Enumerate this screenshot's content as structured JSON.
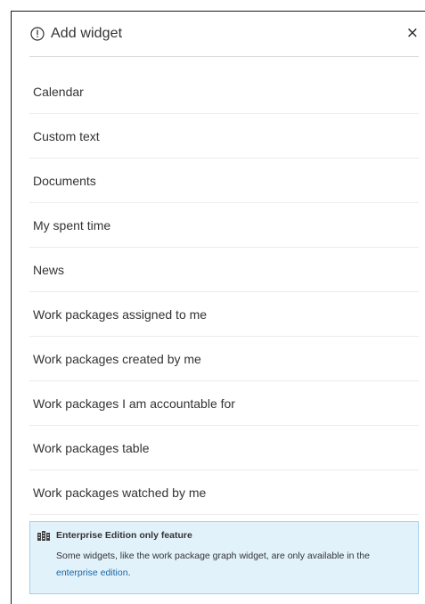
{
  "modal": {
    "title": "Add widget",
    "close_label": "×",
    "icons": {
      "title": "info-icon",
      "close": "close-icon",
      "enterprise": "enterprise-edition-icon"
    }
  },
  "widgets": [
    "Calendar",
    "Custom text",
    "Documents",
    "My spent time",
    "News",
    "Work packages assigned to me",
    "Work packages created by me",
    "Work packages I am accountable for",
    "Work packages table",
    "Work packages watched by me"
  ],
  "enterprise_notice": {
    "heading": "Enterprise Edition only feature",
    "text": "Some widgets, like the work package graph widget, are only available in the",
    "link_text": "enterprise edition",
    "trailing": "."
  },
  "colors": {
    "notice_background": "#e2f2fb",
    "notice_border": "#9fd0ec",
    "link": "#1a67a3"
  }
}
